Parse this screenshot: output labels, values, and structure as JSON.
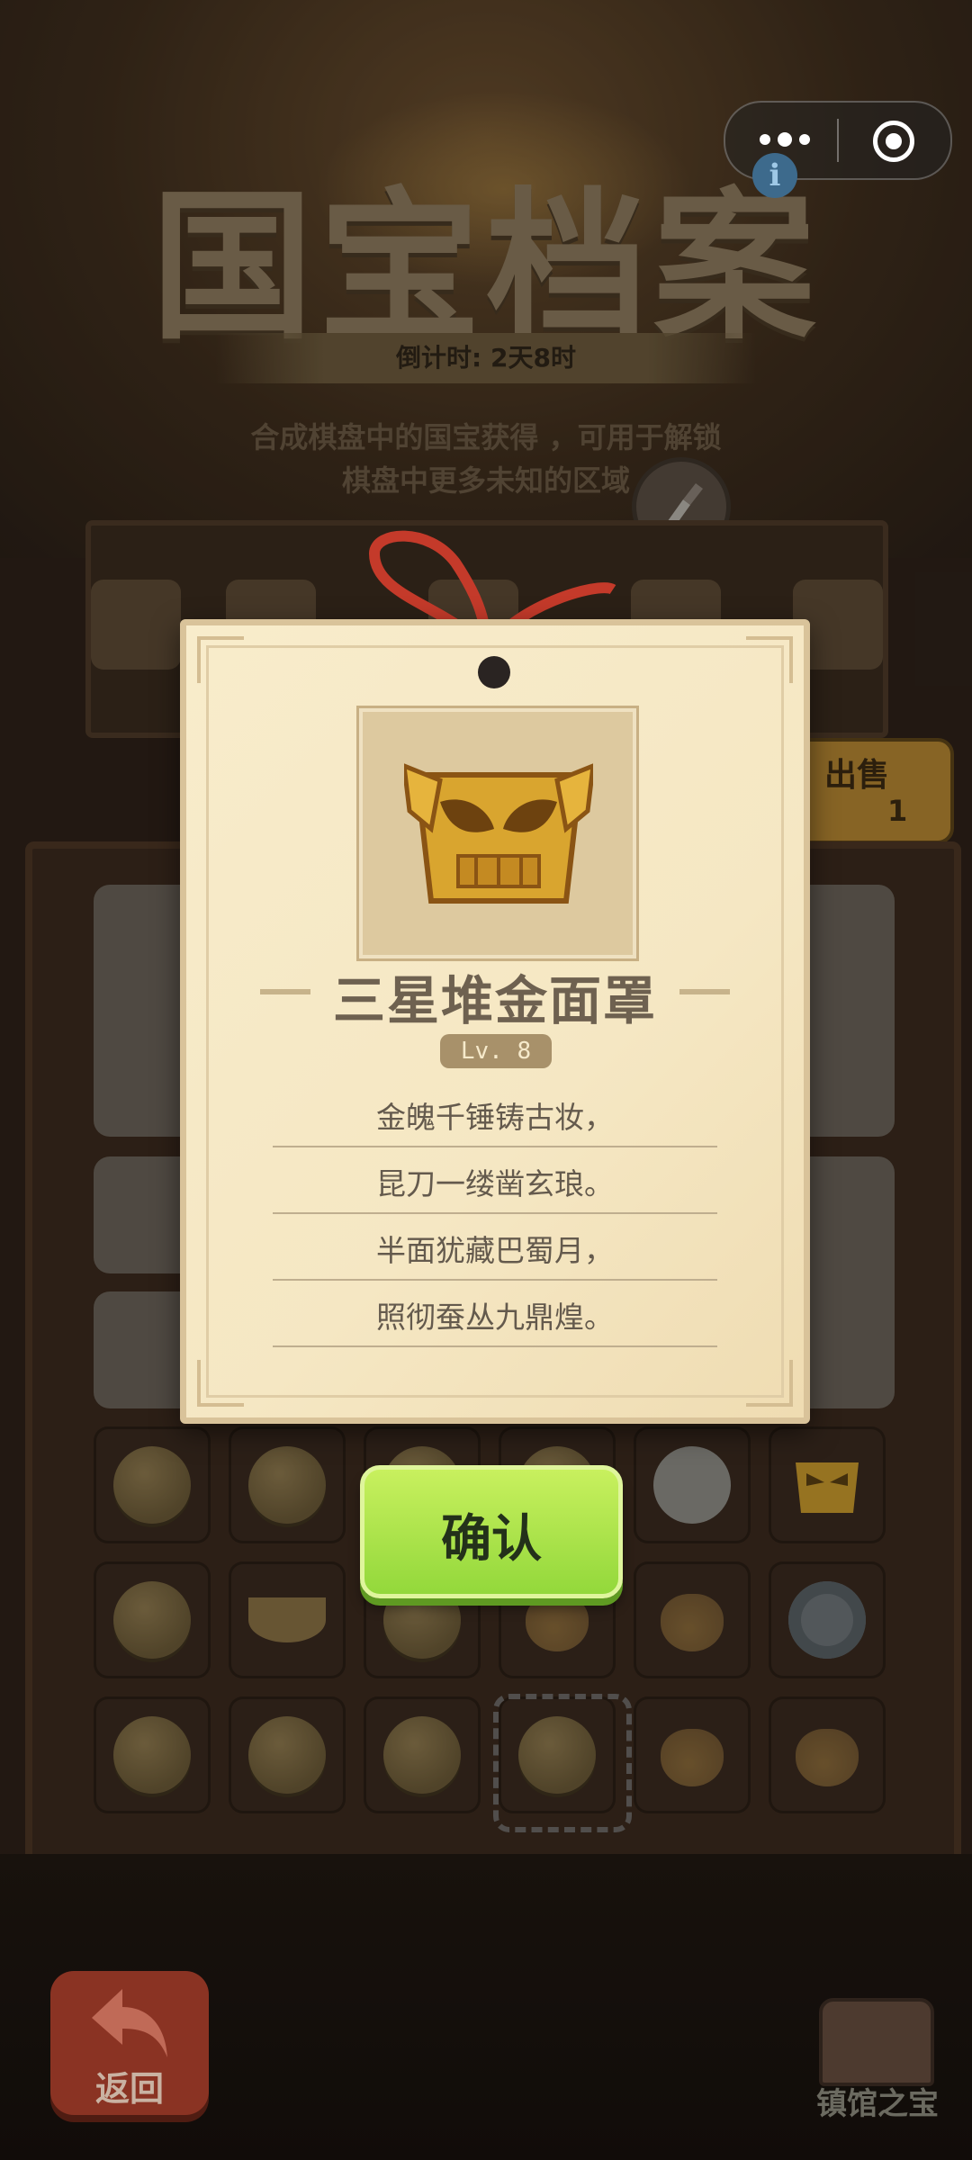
{
  "header": {
    "title": "国宝档案",
    "countdown": "倒计时: 2天8时",
    "intro_line1": "合成棋盘中的国宝获得  ，可用于解锁",
    "intro_line2": "棋盘中更多未知的区域"
  },
  "sell": {
    "label": "出售",
    "count": "1"
  },
  "card": {
    "item_name": "三星堆金面罩",
    "level": "Lv. 8",
    "poem": [
      "金魄千锤铸古妆，",
      "昆刀一缕凿玄琅。",
      "半面犹藏巴蜀月，",
      "照彻蚕丛九鼎煌。"
    ]
  },
  "confirm_label": "确认",
  "footer": {
    "back_label": "返回",
    "treasure_label": "镇馆之宝"
  },
  "icons": {
    "menu": "more-dots-icon",
    "target": "close-target-icon",
    "brush": "brush-icon",
    "mask": "golden-mask-icon",
    "back": "back-arrow-icon"
  },
  "colors": {
    "confirm_green": "#a9e24a",
    "card_paper": "#f6e8c5",
    "back_red": "#8a3323"
  }
}
